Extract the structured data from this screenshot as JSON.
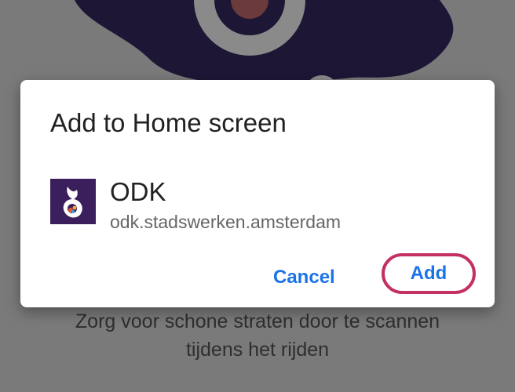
{
  "background": {
    "caption_line1": "Zorg voor schone straten door te scannen",
    "caption_line2": "tijdens het rijden",
    "logo_color": "#1e1635"
  },
  "dialog": {
    "title": "Add to Home screen",
    "app": {
      "icon": "odk-logo-icon",
      "name": "ODK",
      "url": "odk.stadswerken.amsterdam"
    },
    "buttons": {
      "cancel_label": "Cancel",
      "add_label": "Add"
    },
    "accent_color": "#1a73e8",
    "highlight_color": "#c4305f"
  }
}
